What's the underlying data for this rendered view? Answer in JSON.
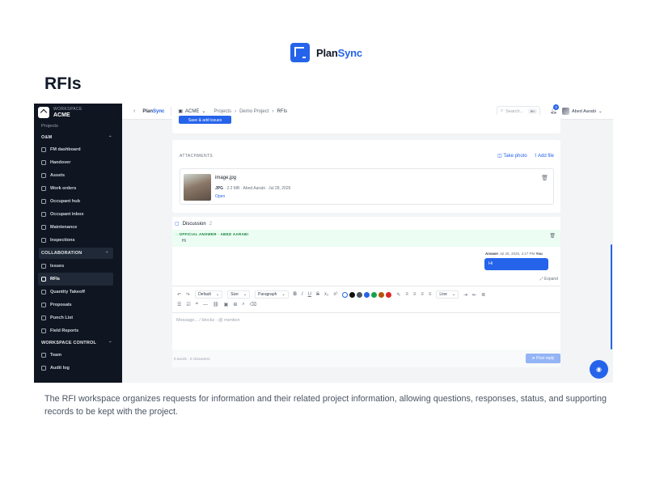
{
  "brand": {
    "name_part1": "Plan",
    "name_part2": "Sync"
  },
  "page": {
    "title": "RFIs",
    "caption": "The RFI workspace organizes requests for information and their related project information, allowing questions, responses, status, and supporting records to be kept with the project."
  },
  "sidebar": {
    "workspace_label": "WORKSPACE",
    "workspace_name": "ACME",
    "projects_label": "Projects",
    "sections": [
      {
        "title": "O&M",
        "items": [
          "FM dashboard",
          "Handover",
          "Assets",
          "Work orders",
          "Occupant hub",
          "Occupant inbox",
          "Maintenance",
          "Inspections"
        ]
      },
      {
        "title": "COLLABORATION",
        "items": [
          "Issues",
          "RFIs",
          "Quantity Takeoff",
          "Proposals",
          "Punch List",
          "Field Reports"
        ]
      },
      {
        "title": "WORKSPACE CONTROL",
        "items": [
          "Team",
          "Audit log"
        ]
      }
    ]
  },
  "topbar": {
    "back": "‹",
    "brand_part1": "Plan",
    "brand_part2": "Sync",
    "org": "ACME",
    "crumbs": [
      "Projects",
      "›",
      "Demo Project",
      "›",
      "RFIs"
    ],
    "search_placeholder": "Search...",
    "search_kbd": "⌘K",
    "notif_count": "3",
    "user_name": "Abed Aarabi"
  },
  "attachments": {
    "title": "ATTACHMENTS",
    "take_photo": "Take photo",
    "add_file": "Add file",
    "file": {
      "name": "image.jpg",
      "type": "JPG",
      "meta": " · 2.2 MB · Abed Aarabi · Jul 28, 2026",
      "open": "Open"
    }
  },
  "discussion": {
    "title": "Discussion",
    "count": "2",
    "official_label": "OFFICIAL ANSWER · ABED AARABI",
    "official_text": "Hi",
    "reply_tag": "Answer",
    "reply_meta": " Jul 28, 2026, 4:17 PM ",
    "reply_author": "You",
    "reply_text": "Hi",
    "expand": "Expand"
  },
  "toolbar": {
    "font": "Default",
    "size": "Size",
    "block": "Paragraph",
    "line": "Line",
    "colors": [
      "#ffffff",
      "#111111",
      "#4b5563",
      "#2563eb",
      "#16a34a",
      "#b45309",
      "#dc2626"
    ]
  },
  "editor": {
    "placeholder": "Message... / blocks · @ mention",
    "counter": "0 words · 0 characters",
    "post": "Post reply"
  },
  "misc": {
    "top_button": "Save & add issues"
  }
}
